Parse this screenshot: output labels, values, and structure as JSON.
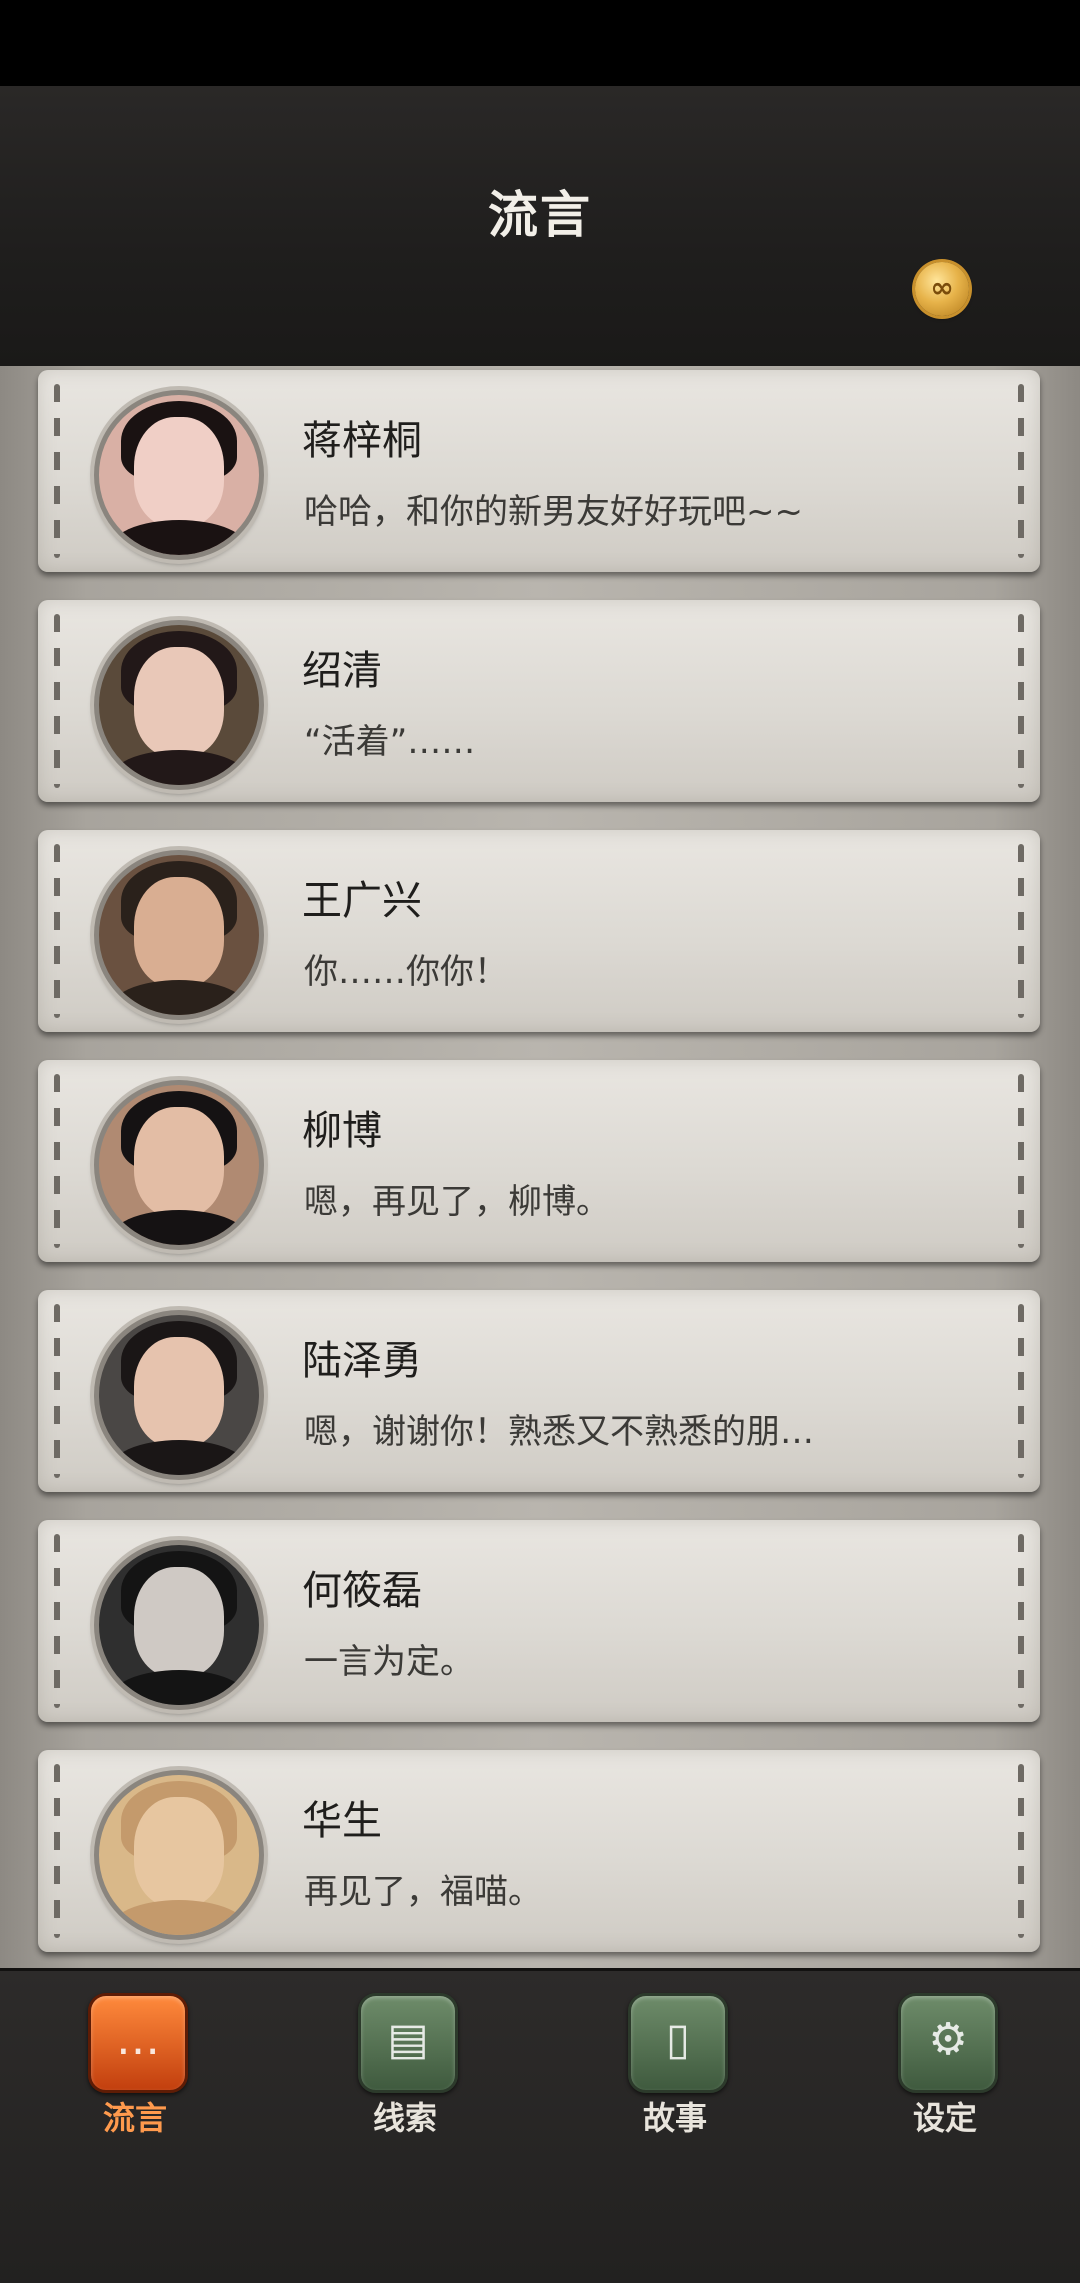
{
  "header": {
    "title": "流言"
  },
  "icons": {
    "coin": "infinity-coin-icon"
  },
  "conversations": [
    {
      "name": "蒋梓桐",
      "message": "哈哈，和你的新男友好好玩吧~~",
      "avatar_skin": "#f0cfc6",
      "avatar_hair": "#1a1212",
      "avatar_bg": "#d9b0a5"
    },
    {
      "name": "绍清",
      "message": "“活着”……",
      "avatar_skin": "#e9c8b8",
      "avatar_hair": "#221818",
      "avatar_bg": "#5a4a3a"
    },
    {
      "name": "王广兴",
      "message": "你……你你！",
      "avatar_skin": "#d9ae92",
      "avatar_hair": "#2a211b",
      "avatar_bg": "#6a5140"
    },
    {
      "name": "柳博",
      "message": "嗯，再见了，柳博。",
      "avatar_skin": "#e3bda5",
      "avatar_hair": "#151213",
      "avatar_bg": "#b08a72"
    },
    {
      "name": "陆泽勇",
      "message": "嗯，谢谢你！熟悉又不熟悉的朋…",
      "avatar_skin": "#e6c3ae",
      "avatar_hair": "#1a1616",
      "avatar_bg": "#4a4745"
    },
    {
      "name": "何筱磊",
      "message": "一言为定。",
      "avatar_skin": "#cfc9c4",
      "avatar_hair": "#141414",
      "avatar_bg": "#2f2f2f"
    },
    {
      "name": "华生",
      "message": "再见了，福喵。",
      "avatar_skin": "#e7c6a0",
      "avatar_hair": "#c49a6c",
      "avatar_bg": "#d9b889"
    }
  ],
  "tabs": [
    {
      "label": "流言",
      "icon": "chat-bubble-icon",
      "active": true
    },
    {
      "label": "线索",
      "icon": "document-icon",
      "active": false
    },
    {
      "label": "故事",
      "icon": "book-icon",
      "active": false
    },
    {
      "label": "设定",
      "icon": "gear-icon",
      "active": false
    }
  ]
}
